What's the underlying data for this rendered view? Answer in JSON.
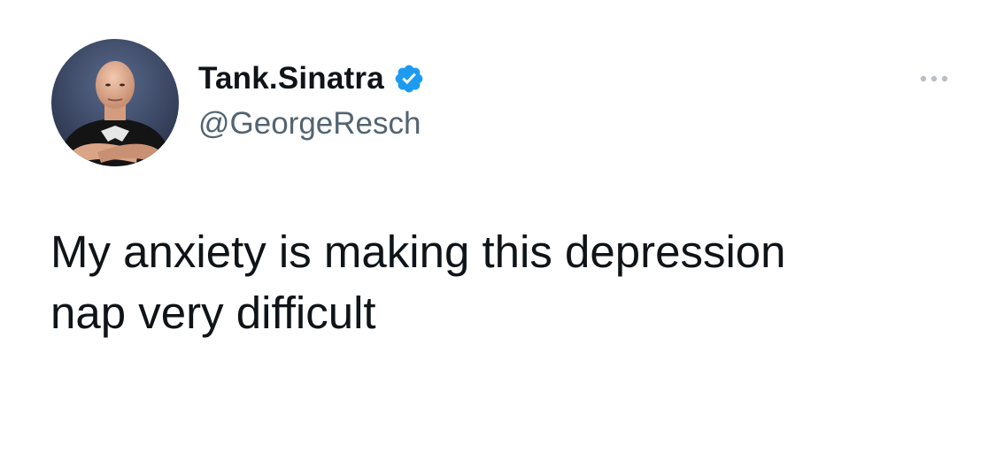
{
  "author": {
    "display_name": "Tank.Sinatra",
    "handle": "@GeorgeResch",
    "verified": true,
    "avatar_icon": "profile-photo"
  },
  "tweet": {
    "text": "My anxiety is making this depression\nnap very difficult"
  },
  "menu": {
    "icon": "more-dots-icon"
  },
  "colors": {
    "text_primary": "#0f1419",
    "text_secondary": "#536471",
    "verified_blue": "#1d9bf0",
    "background": "#ffffff"
  }
}
